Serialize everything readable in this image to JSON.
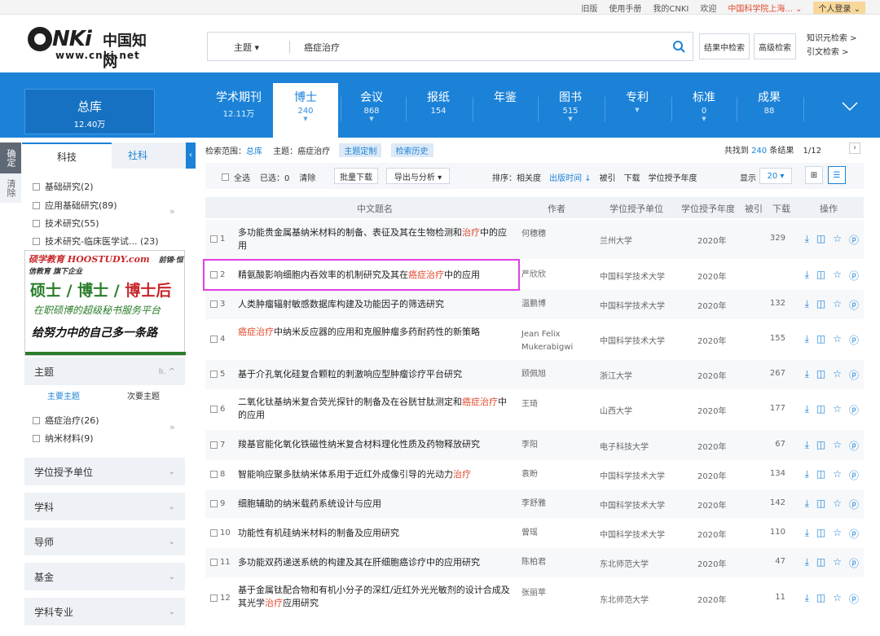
{
  "topbar": {
    "links": [
      "旧版",
      "使用手册",
      "我的CNKI",
      "欢迎"
    ],
    "org": "中国科学院上海... ⌄",
    "login": "个人登录 ⌄"
  },
  "logo": {
    "brand": "NKi",
    "zh": "中国知网",
    "url": "www.cnki.net"
  },
  "search": {
    "field_type": "主题 ▾",
    "query": "癌症治疗",
    "icon": "search-icon",
    "btn_within": "结果中检索",
    "btn_advanced": "高级检索",
    "knowledge": "知识元检索 >",
    "citation": "引文检索 >"
  },
  "nav": {
    "zongku": {
      "label": "总库",
      "count": "12.40万"
    },
    "tabs": [
      {
        "label": "学术期刊",
        "count": "12.11万"
      },
      {
        "label": "博士",
        "count": "240"
      },
      {
        "label": "会议",
        "count": "868"
      },
      {
        "label": "报纸",
        "count": "154"
      },
      {
        "label": "年鉴",
        "count": ""
      },
      {
        "label": "图书",
        "count": "515"
      },
      {
        "label": "专利",
        "count": ""
      },
      {
        "label": "标准",
        "count": "0"
      },
      {
        "label": "成果",
        "count": "88"
      }
    ]
  },
  "sidebar": {
    "vtab1": "确定",
    "vtab2": "清除",
    "subtab_active": "科技",
    "subtab_other": "社科",
    "categories": [
      "基础研究(2)",
      "应用基础研究(89)",
      "技术研究(55)",
      "技术研究-临床医学试... (23)"
    ],
    "ad": {
      "brand": "硕学教育 HOOSTUDY.com",
      "partner": "前锦·恒信教育 旗下企业",
      "line2a": "硕士 / 博士 / ",
      "line2b": "博士后",
      "line3": "在职硕博的超级秘书服务平台",
      "line4": "给努力中的自己多一条路"
    },
    "topic_panel": {
      "title": "主题",
      "sub_main": "主要主题",
      "sub_second": "次要主题",
      "items": [
        "癌症治疗(26)",
        "纳米材料(9)"
      ]
    },
    "panels": [
      "学位授予单位",
      "学科",
      "导师",
      "基金",
      "学科专业"
    ]
  },
  "filter": {
    "scope": "检索范围：",
    "scope_val": "总库",
    "topic": "主题：癌症治疗",
    "pill1": "主题定制",
    "pill2": "检索历史",
    "found_pre": "共找到 ",
    "found_num": "240",
    "found_post": " 条结果",
    "page": "1/12"
  },
  "toolbar": {
    "select_all": "全选",
    "selected": "已选：0",
    "clear": "清除",
    "batch": "批量下载",
    "export": "导出与分析 ▾",
    "sort_label": "排序：相关度",
    "sort_active": "出版时间 ↓",
    "sort_cite": "被引",
    "sort_dl": "下载",
    "sort_year": "学位授予年度",
    "show": "显示",
    "show_num": "20 ▾"
  },
  "table": {
    "headers": {
      "title": "中文题名",
      "author": "作者",
      "unit": "学位授予单位",
      "year": "学位授予年度",
      "cite": "被引",
      "dl": "下载",
      "ops": "操作"
    },
    "rows": [
      {
        "n": "1",
        "pre": "多功能贵金属基纳米材料的制备、表征及其在生物检测和",
        "hl": "治疗",
        "post": "中的应用",
        "author": "何穗穗",
        "unit": "兰州大学",
        "year": "2020年",
        "dl": "329"
      },
      {
        "n": "2",
        "pre": "精氨酸影响细胞内吞效率的机制研究及其在",
        "hl": "癌症治疗",
        "post": "中的应用",
        "author": "严欣欣",
        "unit": "中国科学技术大学",
        "year": "2020年",
        "dl": ""
      },
      {
        "n": "3",
        "pre": "人类肿瘤辐射敏感数据库构建及功能因子的筛选研究",
        "hl": "",
        "post": "",
        "author": "温鹏博",
        "unit": "中国科学技术大学",
        "year": "2020年",
        "dl": "132"
      },
      {
        "n": "4",
        "pre": "",
        "hl": "癌症治疗",
        "post": "中纳米反应器的应用和克服肿瘤多药耐药性的新策略",
        "author": "Jean Felix Mukerabigwi",
        "unit": "中国科学技术大学",
        "year": "2020年",
        "dl": "155"
      },
      {
        "n": "5",
        "pre": "基于介孔氧化硅复合颗粒的刺激响应型肿瘤诊疗平台研究",
        "hl": "",
        "post": "",
        "author": "顾佩旭",
        "unit": "浙江大学",
        "year": "2020年",
        "dl": "267"
      },
      {
        "n": "6",
        "pre": "二氧化钛基纳米复合荧光探针的制备及在谷胱甘肽测定和",
        "hl": "癌症治疗",
        "post": "中的应用",
        "author": "王琦",
        "unit": "山西大学",
        "year": "2020年",
        "dl": "177"
      },
      {
        "n": "7",
        "pre": "羧基官能化氧化铁磁性纳米复合材料理化性质及药物释放研究",
        "hl": "",
        "post": "",
        "author": "李阳",
        "unit": "电子科技大学",
        "year": "2020年",
        "dl": "67"
      },
      {
        "n": "8",
        "pre": "智能响应聚多肽纳米体系用于近红外成像引导的光动力",
        "hl": "治疗",
        "post": "",
        "author": "袁盼",
        "unit": "中国科学技术大学",
        "year": "2020年",
        "dl": "134"
      },
      {
        "n": "9",
        "pre": "细胞辅助的纳米载药系统设计与应用",
        "hl": "",
        "post": "",
        "author": "李舒雅",
        "unit": "中国科学技术大学",
        "year": "2020年",
        "dl": "142"
      },
      {
        "n": "10",
        "pre": "功能性有机硅纳米材料的制备及应用研究",
        "hl": "",
        "post": "",
        "author": "曾瑶",
        "unit": "中国科学技术大学",
        "year": "2020年",
        "dl": "110"
      },
      {
        "n": "11",
        "pre": "多功能双药递送系统的构建及其在肝细胞癌诊疗中的应用研究",
        "hl": "",
        "post": "",
        "author": "陈柏君",
        "unit": "东北师范大学",
        "year": "2020年",
        "dl": "47"
      },
      {
        "n": "12",
        "pre": "基于金属钛配合物和有机小分子的深红/近红外光光敏剂的设计合成及其光学",
        "hl": "治疗",
        "post": "应用研究",
        "author": "张丽苹",
        "unit": "东北师范大学",
        "year": "2020年",
        "dl": "11"
      }
    ]
  }
}
